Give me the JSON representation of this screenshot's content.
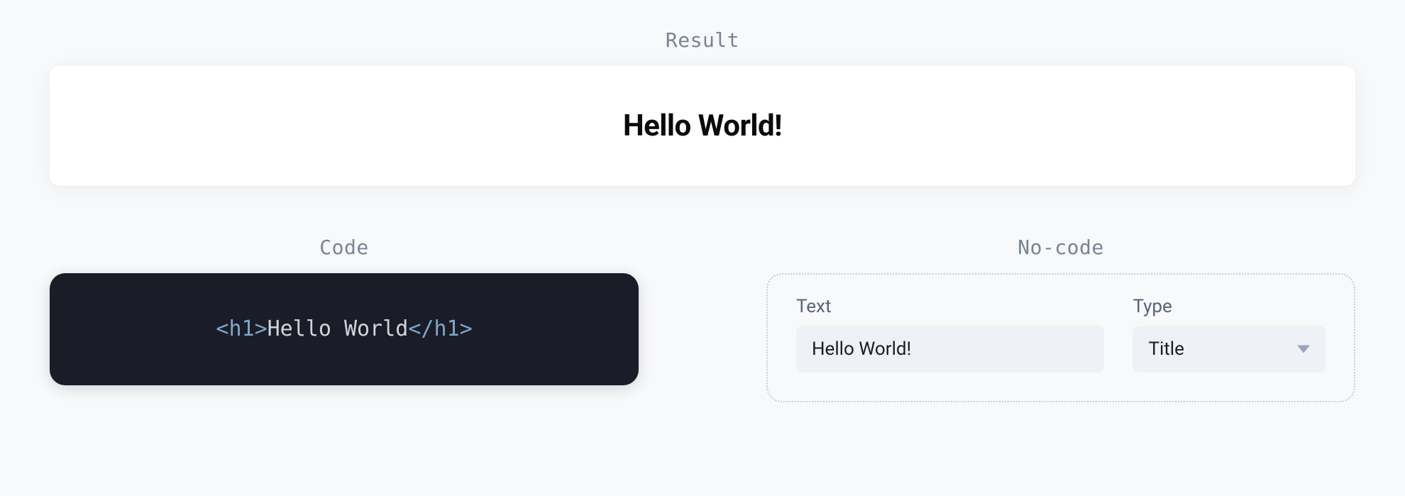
{
  "result": {
    "label": "Result",
    "heading": "Hello World!"
  },
  "code": {
    "label": "Code",
    "open_bracket": "<",
    "tag": "h1",
    "close_open": ">",
    "content": "Hello World",
    "open_close_bracket": "</",
    "close_bracket": ">"
  },
  "nocode": {
    "label": "No-code",
    "text_field": {
      "label": "Text",
      "value": "Hello World!"
    },
    "type_field": {
      "label": "Type",
      "value": "Title"
    }
  }
}
